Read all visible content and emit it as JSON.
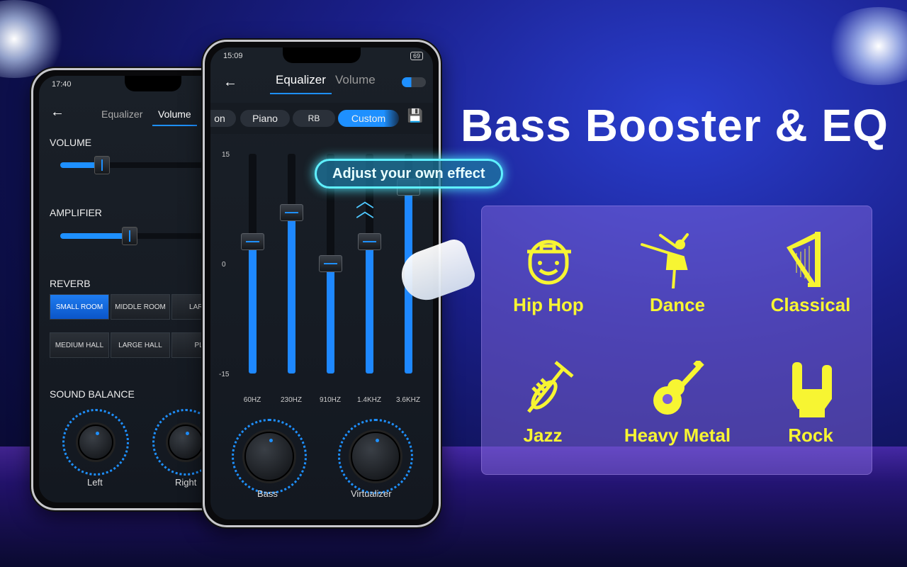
{
  "headline": "Bass Booster & EQ",
  "callout": "Adjust your own effect",
  "colors": {
    "accent": "#1e90ff",
    "genre": "#f7f532",
    "background": "#1a1f8a"
  },
  "back_phone": {
    "status_time": "17:40",
    "tabs": [
      {
        "label": "Equalizer",
        "active": false
      },
      {
        "label": "Volume",
        "active": true
      }
    ],
    "volume": {
      "label": "VOLUME",
      "level": 0.2
    },
    "amplifier": {
      "label": "AMPLIFIER",
      "level": 0.35
    },
    "reverb": {
      "label": "REVERB",
      "options": [
        "SMALL ROOM",
        "MIDDLE ROOM",
        "LARGE",
        "MEDIUM HALL",
        "LARGE HALL",
        "PLA"
      ],
      "selected": "SMALL ROOM"
    },
    "balance": {
      "label": "SOUND BALANCE",
      "left": "Left",
      "right": "Right"
    }
  },
  "front_phone": {
    "status_time": "15:09",
    "battery": "69",
    "tabs": [
      {
        "label": "Equalizer",
        "active": true
      },
      {
        "label": "Volume",
        "active": false
      }
    ],
    "toggle_on": true,
    "presets": [
      "on",
      "Piano",
      "RB",
      "Custom"
    ],
    "selected_preset": "Custom",
    "scale": {
      "max": "15",
      "mid": "0",
      "min": "-15"
    },
    "bands": [
      {
        "freq": "60HZ",
        "gain": 3
      },
      {
        "freq": "230HZ",
        "gain": 7
      },
      {
        "freq": "910HZ",
        "gain": 0
      },
      {
        "freq": "1.4KHZ",
        "gain": 3
      },
      {
        "freq": "3.6KHZ",
        "gain": 10.5
      }
    ],
    "knobs": {
      "bass": "Bass",
      "virtualizer": "Virtualizer"
    }
  },
  "genres": [
    {
      "label": "Hip Hop",
      "icon": "hip-hop-face-icon"
    },
    {
      "label": "Dance",
      "icon": "ballerina-icon"
    },
    {
      "label": "Classical",
      "icon": "harp-icon"
    },
    {
      "label": "Jazz",
      "icon": "trumpet-icon"
    },
    {
      "label": "Heavy Metal",
      "icon": "guitar-icon"
    },
    {
      "label": "Rock",
      "icon": "rock-hand-icon"
    }
  ]
}
